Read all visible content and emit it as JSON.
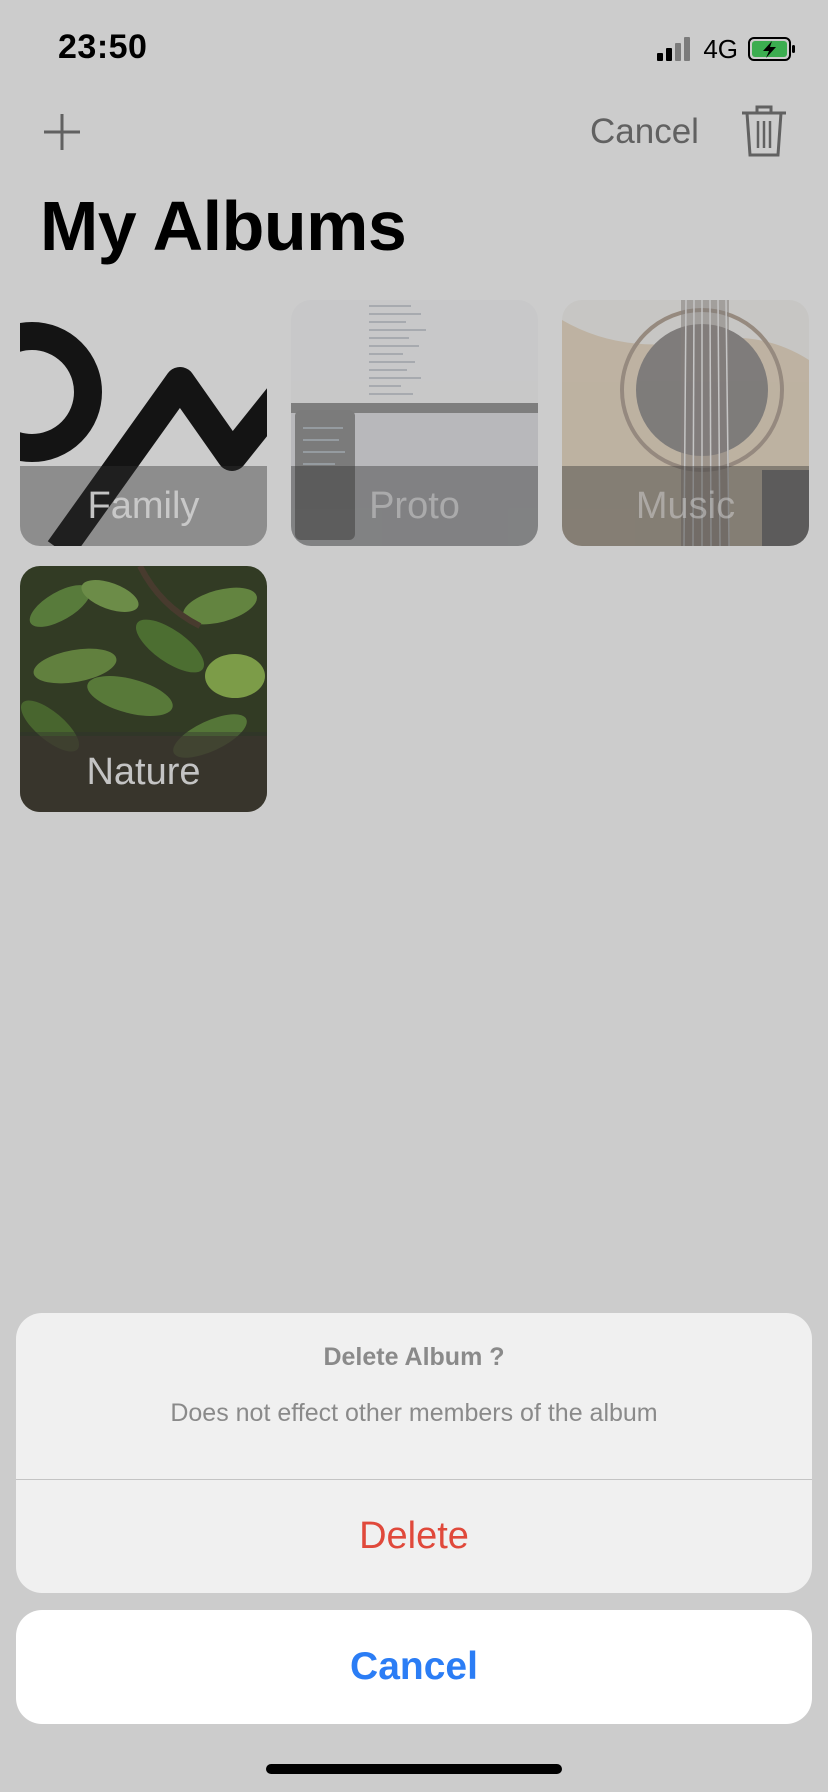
{
  "status_bar": {
    "time": "23:50",
    "network": "4G",
    "icons": {
      "signal": "cellular-signal-icon",
      "battery": "battery-charging-icon"
    },
    "battery_color": "#4cd964"
  },
  "nav": {
    "add_icon": "plus-icon",
    "cancel_label": "Cancel",
    "trash_icon": "trash-icon"
  },
  "page": {
    "title": "My Albums"
  },
  "albums": [
    {
      "label": "Family",
      "art": "wave-logo"
    },
    {
      "label": "Proto",
      "art": "laptop-code-photo"
    },
    {
      "label": "Music",
      "art": "guitar-photo"
    },
    {
      "label": "Nature",
      "art": "plant-photo"
    }
  ],
  "action_sheet": {
    "title": "Delete Album ?",
    "message": "Does not effect other members of the album",
    "destructive_label": "Delete",
    "cancel_label": "Cancel"
  },
  "colors": {
    "destructive": "#e0493b",
    "accent": "#2b7df5",
    "overlay_tint": "#cccccc"
  }
}
